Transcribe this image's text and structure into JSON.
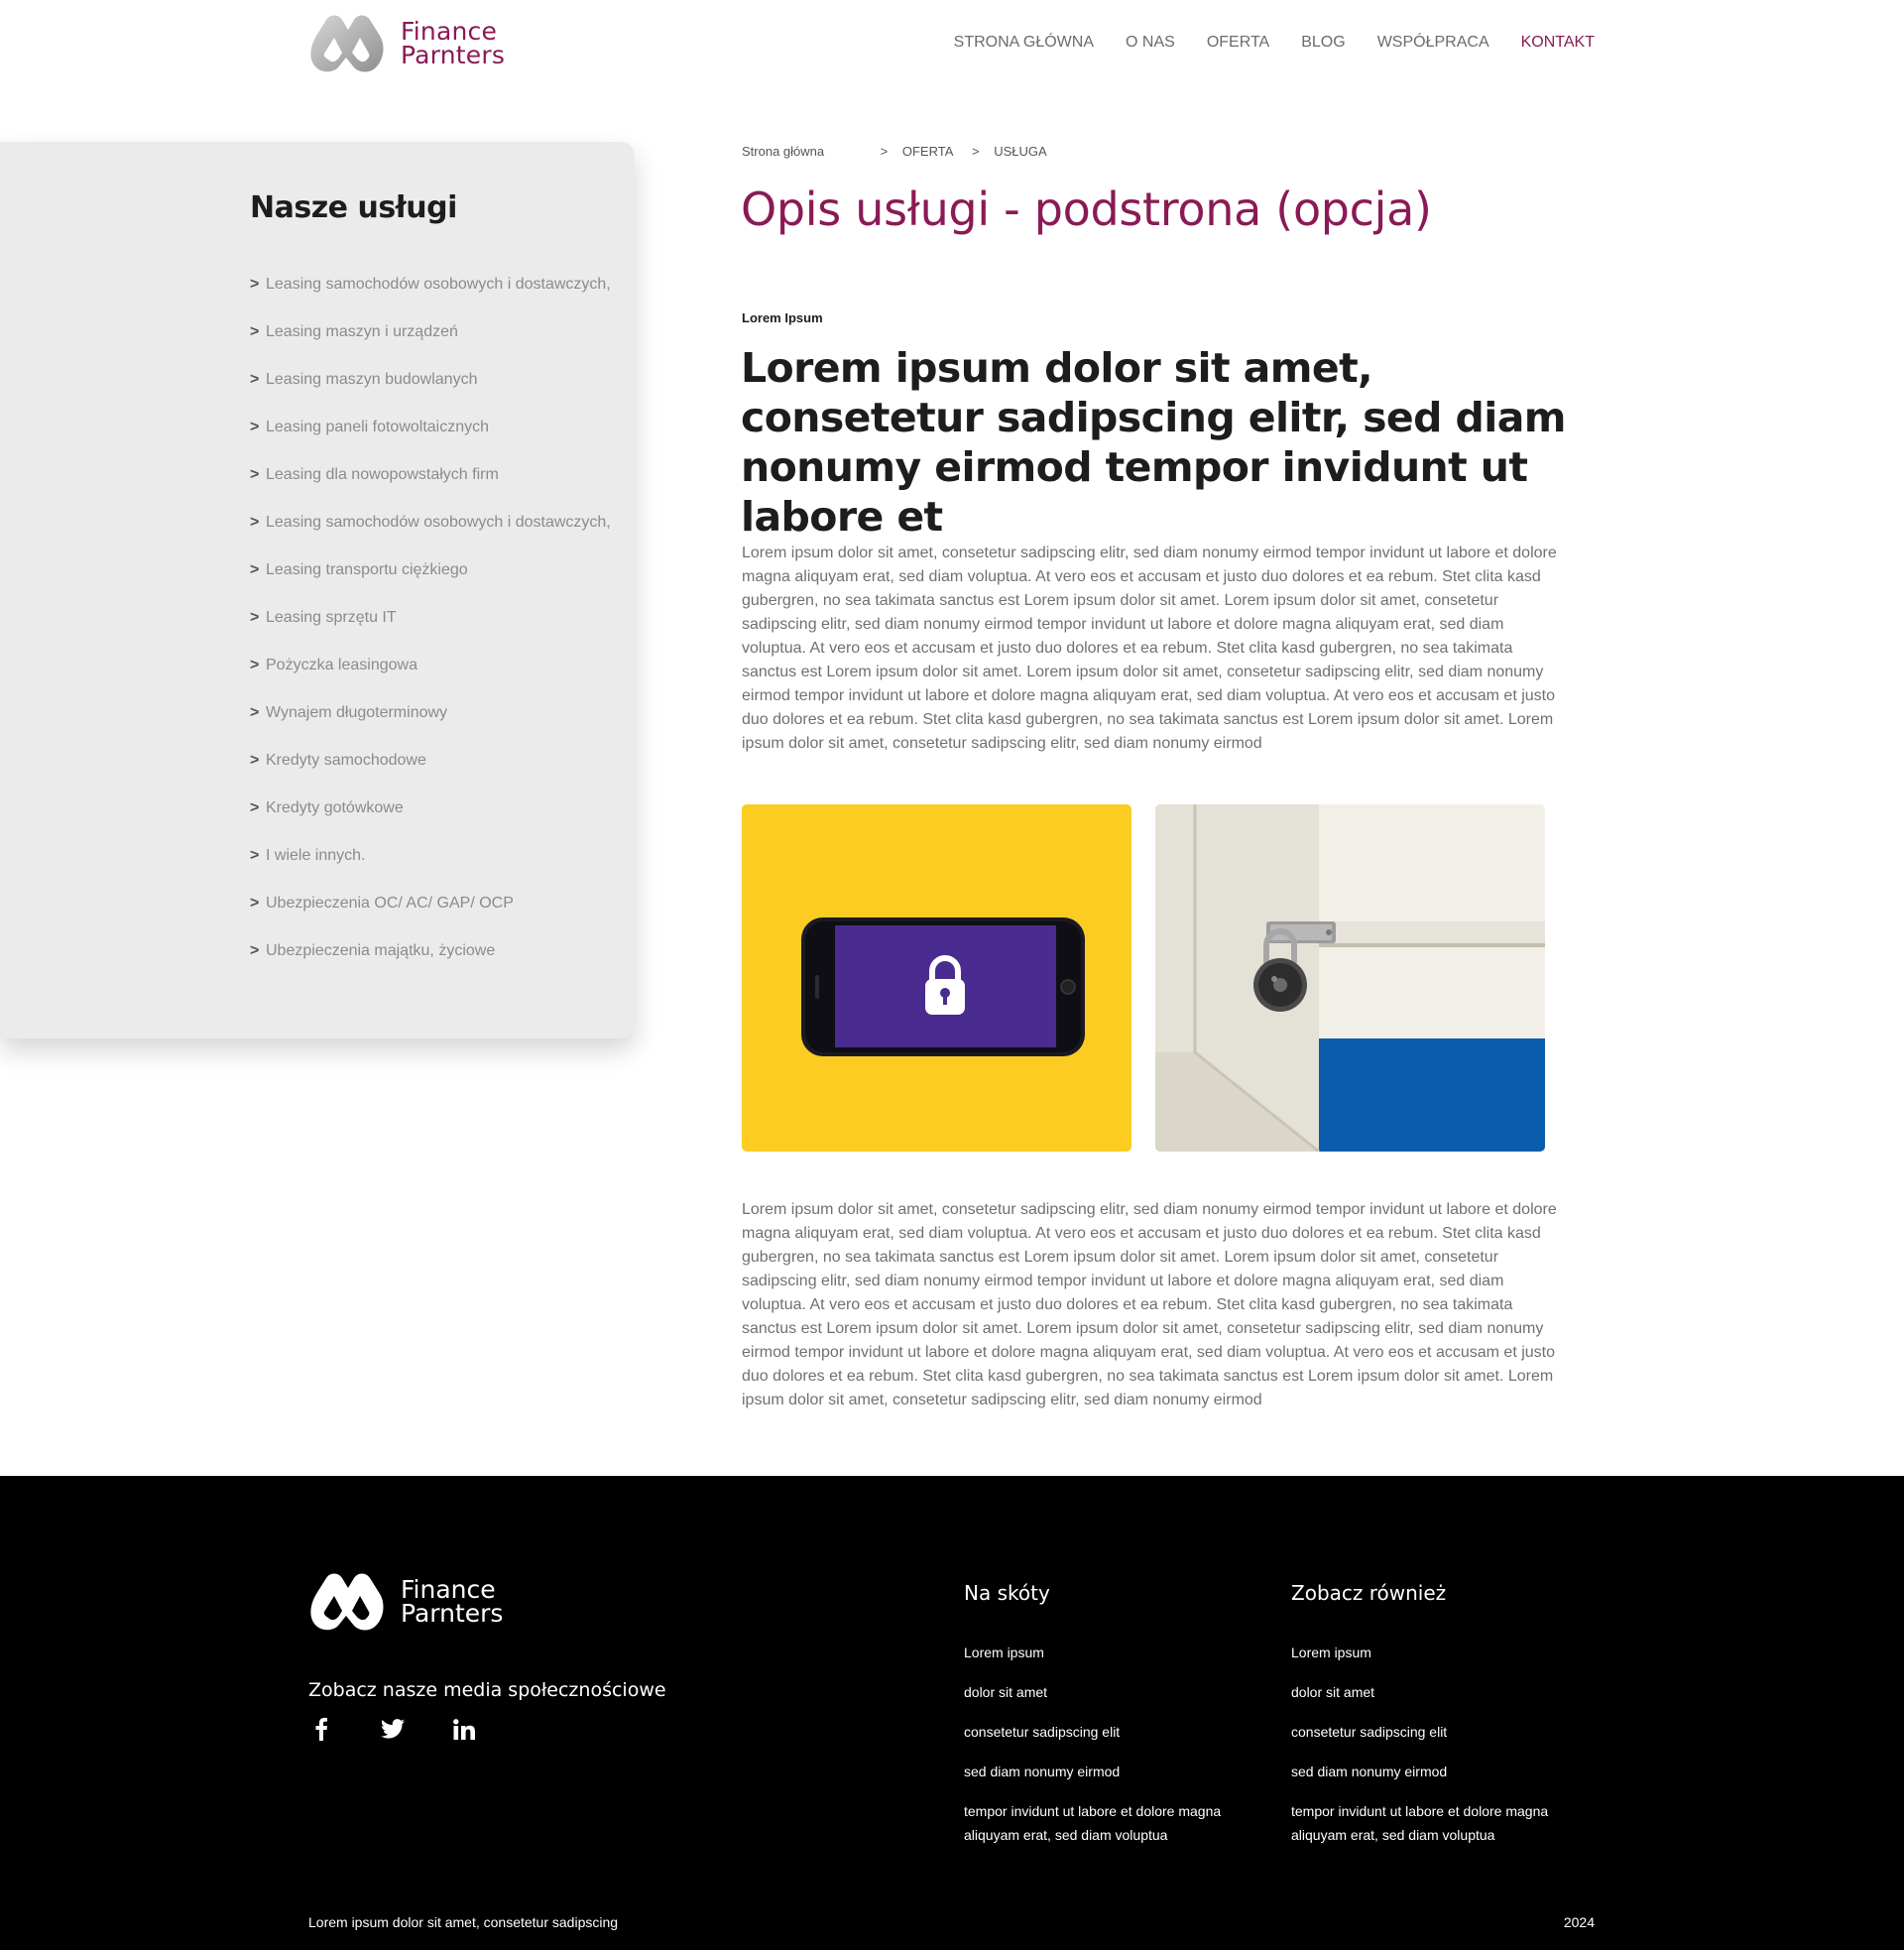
{
  "brand": {
    "name_line1": "Finance",
    "name_line2": "Parnters",
    "color": "#8a1a55"
  },
  "nav": {
    "items": [
      {
        "label": "STRONA GŁÓWNA"
      },
      {
        "label": "O NAS"
      },
      {
        "label": "OFERTA"
      },
      {
        "label": "BLOG"
      },
      {
        "label": "WSPÓŁPRACA"
      },
      {
        "label": "KONTAKT",
        "active": true
      }
    ]
  },
  "sidebar": {
    "title": "Nasze usługi",
    "chevron": ">",
    "items": [
      {
        "label": "Leasing samochodów osobowych i dostawczych,"
      },
      {
        "label": "Leasing maszyn i urządzeń"
      },
      {
        "label": "Leasing maszyn budowlanych"
      },
      {
        "label": "Leasing paneli fotowoltaicznych"
      },
      {
        "label": "Leasing dla nowopowstałych firm"
      },
      {
        "label": "Leasing samochodów osobowych i dostawczych,"
      },
      {
        "label": "Leasing transportu ciężkiego"
      },
      {
        "label": "Leasing sprzętu IT"
      },
      {
        "label": "Pożyczka leasingowa"
      },
      {
        "label": "Wynajem długoterminowy"
      },
      {
        "label": "Kredyty samochodowe"
      },
      {
        "label": "Kredyty gotówkowe"
      },
      {
        "label": "I wiele innych."
      },
      {
        "label": "Ubezpieczenia OC/ AC/ GAP/ OCP"
      },
      {
        "label": "Ubezpieczenia majątku, życiowe"
      }
    ]
  },
  "breadcrumb": {
    "home": "Strona główna",
    "separator": ">",
    "level1": "OFERTA",
    "level2": "USŁUGA"
  },
  "main": {
    "title": "Opis usługi - podstrona (opcja)",
    "kicker": "Lorem Ipsum",
    "headline": "Lorem ipsum dolor sit amet, consetetur sadipscing elitr, sed diam nonumy eirmod tempor invidunt ut labore et",
    "paragraph1": "Lorem ipsum dolor sit amet, consetetur sadipscing elitr, sed diam nonumy eirmod tempor invidunt ut labore et dolore magna aliquyam erat, sed diam voluptua. At vero eos et accusam et justo duo dolores et ea rebum. Stet clita kasd gubergren, no sea takimata sanctus est Lorem ipsum dolor sit amet. Lorem ipsum dolor sit amet, consetetur sadipscing elitr, sed diam nonumy eirmod tempor invidunt ut labore et dolore magna aliquyam erat, sed diam voluptua. At vero eos et accusam et justo duo dolores et ea rebum. Stet clita kasd gubergren, no sea takimata sanctus est Lorem ipsum dolor sit amet. Lorem ipsum dolor sit amet, consetetur sadipscing elitr, sed diam nonumy eirmod tempor invidunt ut labore et dolore magna aliquyam erat, sed diam voluptua. At vero eos et accusam et justo duo dolores et ea rebum. Stet clita kasd gubergren, no sea takimata sanctus est Lorem ipsum dolor sit amet. Lorem ipsum dolor sit amet, consetetur sadipscing elitr, sed diam nonumy eirmod",
    "paragraph2": "Lorem ipsum dolor sit amet, consetetur sadipscing elitr, sed diam nonumy eirmod tempor invidunt ut labore et dolore magna aliquyam erat, sed diam voluptua. At vero eos et accusam et justo duo dolores et ea rebum. Stet clita kasd gubergren, no sea takimata sanctus est Lorem ipsum dolor sit amet. Lorem ipsum dolor sit amet, consetetur sadipscing elitr, sed diam nonumy eirmod tempor invidunt ut labore et dolore magna aliquyam erat, sed diam voluptua. At vero eos et accusam et justo duo dolores et ea rebum. Stet clita kasd gubergren, no sea takimata sanctus est Lorem ipsum dolor sit amet. Lorem ipsum dolor sit amet, consetetur sadipscing elitr, sed diam nonumy eirmod tempor invidunt ut labore et dolore magna aliquyam erat, sed diam voluptua. At vero eos et accusam et justo duo dolores et ea rebum. Stet clita kasd gubergren, no sea takimata sanctus est Lorem ipsum dolor sit amet. Lorem ipsum dolor sit amet, consetetur sadipscing elitr, sed diam nonumy eirmod",
    "images": [
      {
        "subject": "phone-with-lock-icon",
        "bg_color": "#fbc915",
        "screen_color": "#4a2b8f"
      },
      {
        "subject": "combination-padlock-on-door",
        "accent_color": "#0b5cad"
      }
    ]
  },
  "footer": {
    "social_title": "Zobacz nasze media społecznościowe",
    "social_icons": [
      "facebook-icon",
      "twitter-icon",
      "linkedin-icon"
    ],
    "col1": {
      "title": "Na skóty",
      "links": [
        {
          "label": "Lorem ipsum"
        },
        {
          "label": "dolor sit amet"
        },
        {
          "label": "consetetur sadipscing elit"
        },
        {
          "label": "sed diam nonumy eirmod"
        },
        {
          "label": "tempor invidunt ut labore et dolore magna aliquyam erat, sed diam voluptua"
        }
      ]
    },
    "col2": {
      "title": "Zobacz również",
      "links": [
        {
          "label": "Lorem ipsum"
        },
        {
          "label": "dolor sit amet"
        },
        {
          "label": "consetetur sadipscing elit"
        },
        {
          "label": "sed diam nonumy eirmod"
        },
        {
          "label": "tempor invidunt ut labore et dolore magna aliquyam erat, sed diam voluptua"
        }
      ]
    },
    "bottom_text": "Lorem ipsum dolor sit amet, consetetur sadipscing",
    "year": "2024"
  }
}
